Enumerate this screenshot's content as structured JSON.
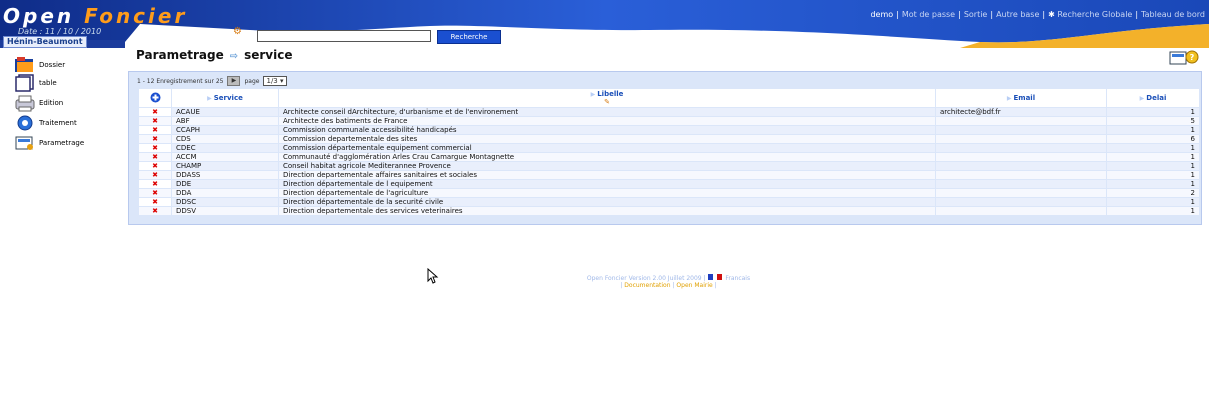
{
  "header": {
    "logo_white": "Open ",
    "logo_orange": "Foncier",
    "date": "Date : 11 / 10 / 2010",
    "city": "Hénin-Beaumont",
    "menu": [
      {
        "label": "demo",
        "current": true
      },
      {
        "label": "Mot de passe"
      },
      {
        "label": "Sortie"
      },
      {
        "label": "Autre base"
      },
      {
        "label": "Recherche Globale"
      },
      {
        "label": "Tableau de bord"
      }
    ],
    "search_button": "Recherche",
    "search_value": ""
  },
  "sidebar": {
    "items": [
      {
        "label": "Dossier",
        "icon": "dossier-icon"
      },
      {
        "label": "table",
        "icon": "table-icon"
      },
      {
        "label": "Edition",
        "icon": "edition-icon"
      },
      {
        "label": "Traitement",
        "icon": "traitement-icon"
      },
      {
        "label": "Parametrage",
        "icon": "parametrage-icon"
      }
    ]
  },
  "page": {
    "title": "Parametrage",
    "subtitle": "service"
  },
  "pager": {
    "text": "1 - 12 Enregistrement sur 25",
    "page_label": "page",
    "page_value": "1/3"
  },
  "table": {
    "columns": [
      "Service",
      "Libelle",
      "Email",
      "Delai"
    ],
    "rows": [
      {
        "service": "ACAUE",
        "libelle": "Architecte conseil dArchitecture, d'urbanisme et de l'environement",
        "email": "architecte@bdf.fr",
        "delai": "1"
      },
      {
        "service": "ABF",
        "libelle": "Architecte des batiments de France",
        "email": "",
        "delai": "5"
      },
      {
        "service": "CCAPH",
        "libelle": "Commission communale accessibilité handicapés",
        "email": "",
        "delai": "1"
      },
      {
        "service": "CDS",
        "libelle": "Commission departementale des sites",
        "email": "",
        "delai": "6"
      },
      {
        "service": "CDEC",
        "libelle": "Commission départementale equipement commercial",
        "email": "",
        "delai": "1"
      },
      {
        "service": "ACCM",
        "libelle": "Communauté d'agglomération Arles Crau Camargue Montagnette",
        "email": "",
        "delai": "1"
      },
      {
        "service": "CHAMP",
        "libelle": "Conseil habitat agricole Mediterannee Provence",
        "email": "",
        "delai": "1"
      },
      {
        "service": "DDASS",
        "libelle": "Direction departementale affaires sanitaires et sociales",
        "email": "",
        "delai": "1"
      },
      {
        "service": "DDE",
        "libelle": "Direction départementale de l equipement",
        "email": "",
        "delai": "1"
      },
      {
        "service": "DDA",
        "libelle": "Direction départementale de l'agriculture",
        "email": "",
        "delai": "2"
      },
      {
        "service": "DDSC",
        "libelle": "Direction départementale de la securité civile",
        "email": "",
        "delai": "1"
      },
      {
        "service": "DDSV",
        "libelle": "Direction departementale des services veterinaires",
        "email": "",
        "delai": "1"
      }
    ]
  },
  "footer": {
    "version": "Open Foncier  Version 2.00 Juillet 2009 |",
    "lang": "Francais",
    "doc": "Documentation",
    "mairie": "Open Mairie",
    "sep": "|"
  },
  "colors": {
    "accent": "#1a4fd0",
    "brand_orange": "#ff9c1a",
    "panel": "#dbe6f9",
    "header_dark": "#0f2c88"
  }
}
